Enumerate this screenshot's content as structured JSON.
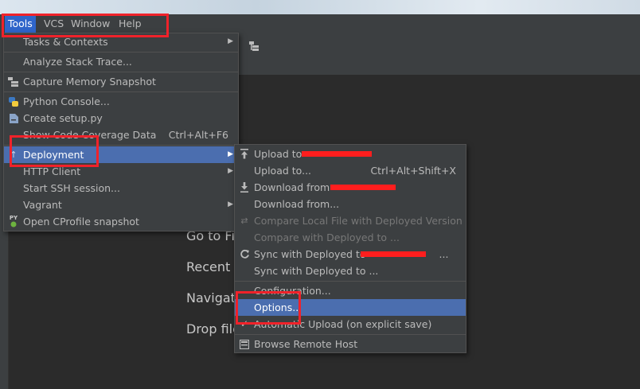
{
  "menubar": {
    "items": [
      {
        "label": "Tools",
        "active": true
      },
      {
        "label": "VCS"
      },
      {
        "label": "Window"
      },
      {
        "label": "Help"
      }
    ]
  },
  "welcome": {
    "lines": [
      "Go to Fi",
      "Recent F",
      "Navigat",
      "Drop file"
    ]
  },
  "tools_menu": {
    "items": [
      {
        "label": "Tasks & Contexts",
        "submenu": true
      },
      {
        "label": "Analyze Stack Trace..."
      },
      {
        "label": "Capture Memory Snapshot",
        "icon": "memory-snapshot-icon"
      },
      {
        "label": "Python Console...",
        "icon": "python-icon"
      },
      {
        "label": "Create setup.py",
        "icon": "file-icon"
      },
      {
        "label": "Show Code Coverage Data",
        "shortcut": "Ctrl+Alt+F6"
      },
      {
        "label": "Deployment",
        "submenu": true,
        "selected": true,
        "icon": "upload-arrow-icon"
      },
      {
        "label": "HTTP Client",
        "submenu": true
      },
      {
        "label": "Start SSH session..."
      },
      {
        "label": "Vagrant",
        "submenu": true
      },
      {
        "label": "Open CProfile snapshot",
        "icon": "cprofile-icon",
        "icon_text": "PY"
      }
    ]
  },
  "deployment_menu": {
    "items": [
      {
        "label": "Upload to",
        "icon": "upload-icon"
      },
      {
        "label": "Upload to...",
        "shortcut": "Ctrl+Alt+Shift+X"
      },
      {
        "label": "Download from",
        "icon": "download-icon"
      },
      {
        "label": "Download from..."
      },
      {
        "label": "Compare Local File with Deployed Version",
        "disabled": true,
        "icon": "compare-icon"
      },
      {
        "label": "Compare with Deployed to ...",
        "disabled": true
      },
      {
        "label": "Sync with Deployed to",
        "icon": "sync-icon",
        "suffix": "..."
      },
      {
        "label": "Sync with Deployed to ..."
      },
      {
        "label": "Configuration..."
      },
      {
        "label": "Options...",
        "selected": true
      },
      {
        "label": "Automatic Upload (on explicit save)",
        "checked": true,
        "icon": "checkmark-icon"
      },
      {
        "label": "Browse Remote Host",
        "icon": "remote-host-icon"
      }
    ]
  },
  "colors": {
    "annotation": "#f0222a",
    "selection": "#4b6eaf",
    "menubar_active": "#2f65ca"
  }
}
